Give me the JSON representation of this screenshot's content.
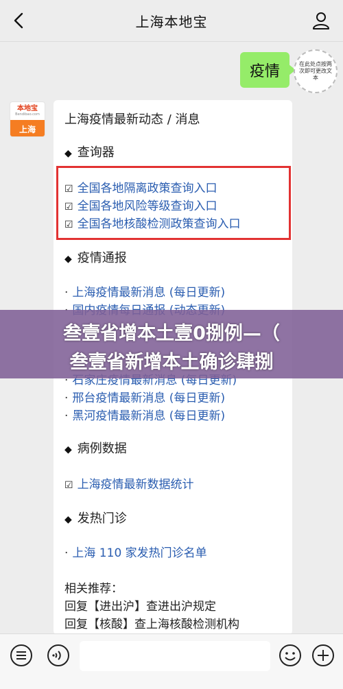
{
  "header": {
    "title": "上海本地宝"
  },
  "chat": {
    "my_message": "疫情",
    "sticker_text": "在此处点按两次即可更改文本",
    "avatar": {
      "name": "本地宝",
      "url": "Bendibao.com",
      "city": "上海"
    }
  },
  "card": {
    "title": "上海疫情最新动态 / 消息",
    "sections": {
      "query": "查询器",
      "report": "疫情通报",
      "cases": "病例数据",
      "fever": "发热门诊"
    },
    "query_items": [
      "全国各地隔离政策查询入口",
      "全国各地风险等级查询入口",
      "全国各地核酸检测政策查询入口"
    ],
    "report_items": [
      "上海疫情最新消息 (每日更新)",
      "国内疫情每日通报 (动态更新)",
      "石家庄疫情最新消息 (每日更新)",
      "邢台疫情最新消息 (每日更新)",
      "黑河疫情最新消息 (每日更新)"
    ],
    "cases_item": "上海疫情最新数据统计",
    "fever_item": "上海 110 家发热门诊名单",
    "recommend": {
      "label": "相关推荐：",
      "items": [
        "回复【进出沪】查进出沪规定",
        "回复【核酸】查上海核酸检测机构"
      ]
    }
  },
  "banner": {
    "line1": "叁壹省增本土壹0捌例—（",
    "line2": "叁壹省新增本土确诊肆捌"
  }
}
